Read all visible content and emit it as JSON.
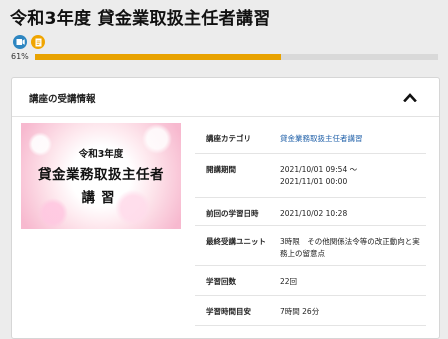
{
  "header": {
    "title": "令和3年度 貸金業取扱主任者講習"
  },
  "icons": [
    {
      "name": "video-icon",
      "color": "#2e86c1"
    },
    {
      "name": "document-icon",
      "color": "#f0a500"
    }
  ],
  "progress": {
    "label": "61%",
    "value": 0.61,
    "color": "#e8a200"
  },
  "card": {
    "title": "講座の受講情報",
    "toggle_icon": "chevron-up-icon",
    "cover": {
      "line1": "令和3年度",
      "line2": "貸金業務取扱主任者",
      "line3": "講習"
    },
    "rows": [
      {
        "label": "講座カテゴリ",
        "value": "貸金業務取扱主任者講習",
        "is_link": true
      },
      {
        "label": "開講期間",
        "value": "2021/10/01 09:54 ～\n2021/11/01 00:00"
      },
      {
        "label": "前回の学習日時",
        "value": "2021/10/02 10:28"
      },
      {
        "label": "最終受講ユニット",
        "value": "3時限　その他関係法令等の改正動向と実務上の留意点"
      },
      {
        "label": "学習回数",
        "value": "22回"
      },
      {
        "label": "学習時間目安",
        "value": "7時間 26分"
      }
    ]
  }
}
